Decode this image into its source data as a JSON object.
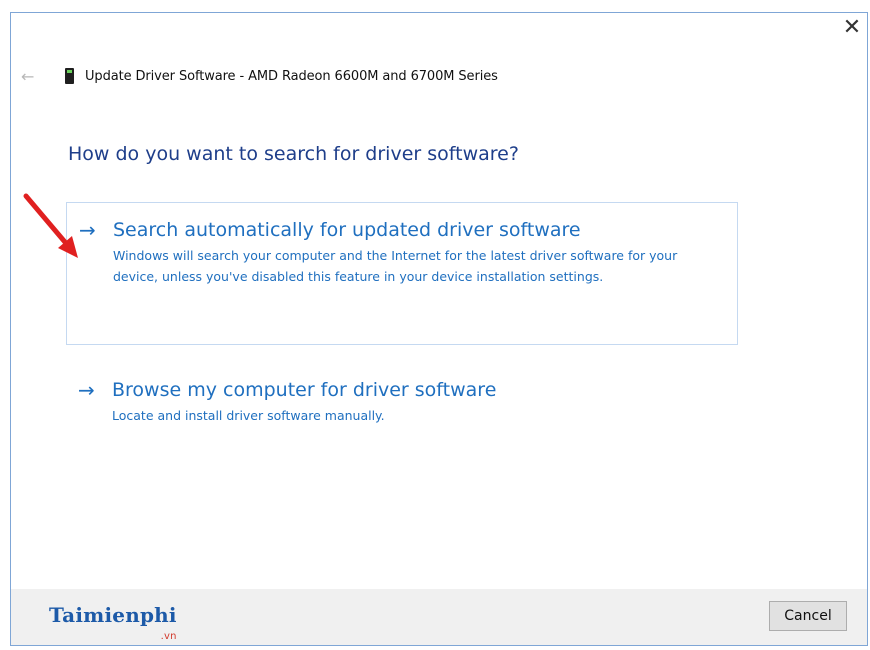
{
  "window": {
    "title": "Update Driver Software - AMD Radeon 6600M and 6700M Series",
    "close_glyph": "✕"
  },
  "nav": {
    "back_glyph": "←",
    "device_icon": "display-adapter-icon"
  },
  "heading": "How do you want to search for driver software?",
  "options": [
    {
      "arrow": "→",
      "title": "Search automatically for updated driver software",
      "description": "Windows will search your computer and the Internet for the latest driver software for your device, unless you've disabled this feature in your device installation settings."
    },
    {
      "arrow": "→",
      "title": "Browse my computer for driver software",
      "description": "Locate and install driver software manually."
    }
  ],
  "footer": {
    "logo_text": "Taimienphi",
    "logo_suffix": ".vn",
    "cancel_label": "Cancel"
  },
  "colors": {
    "accent": "#1f6fbf",
    "heading": "#1e3e8a",
    "annotation": "#e02020"
  }
}
